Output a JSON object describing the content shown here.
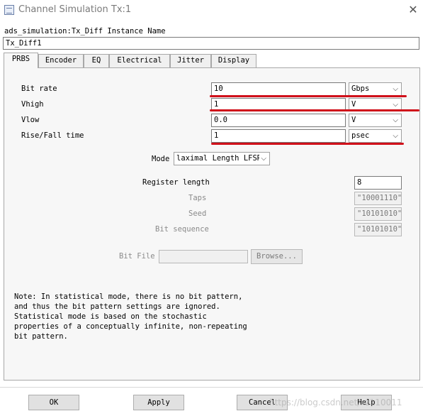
{
  "window": {
    "title": "Channel Simulation Tx:1",
    "close_icon": "close-icon"
  },
  "instance": {
    "label": "ads_simulation:Tx_Diff Instance Name",
    "value": "Tx_Diff1"
  },
  "tabs": [
    {
      "label": "PRBS",
      "active": true
    },
    {
      "label": "Encoder"
    },
    {
      "label": "EQ"
    },
    {
      "label": "Electrical"
    },
    {
      "label": "Jitter"
    },
    {
      "label": "Display"
    }
  ],
  "params": [
    {
      "label": "Bit rate",
      "value": "10",
      "unit": "Gbps"
    },
    {
      "label": "Vhigh",
      "value": "1",
      "unit": "V"
    },
    {
      "label": "Vlow",
      "value": "0.0",
      "unit": "V"
    },
    {
      "label": "Rise/Fall time",
      "value": "1",
      "unit": "psec"
    }
  ],
  "mode": {
    "label": "Mode",
    "value": "laximal Length LFSR"
  },
  "register": {
    "label": "Register length",
    "value": "8"
  },
  "taps": {
    "label": "Taps",
    "value": "\"10001110\""
  },
  "seed": {
    "label": "Seed",
    "value": "\"10101010\""
  },
  "bit_sequence": {
    "label": "Bit sequence",
    "value": "\"10101010\""
  },
  "bit_file": {
    "label": "Bit File",
    "value": "",
    "browse_label": "Browse..."
  },
  "note": "Note: In statistical mode, there is no bit pattern,\nand thus the bit pattern settings are ignored.\nStatistical mode is based on the stochastic\nproperties of a conceptually infinite, non-repeating\nbit pattern.",
  "buttons": {
    "ok": "OK",
    "apply": "Apply",
    "cancel": "Cancel",
    "help": "Help"
  },
  "watermark": "https://blog.csdn.net/xz110011",
  "colors": {
    "annotation_red": "#d0101a"
  }
}
